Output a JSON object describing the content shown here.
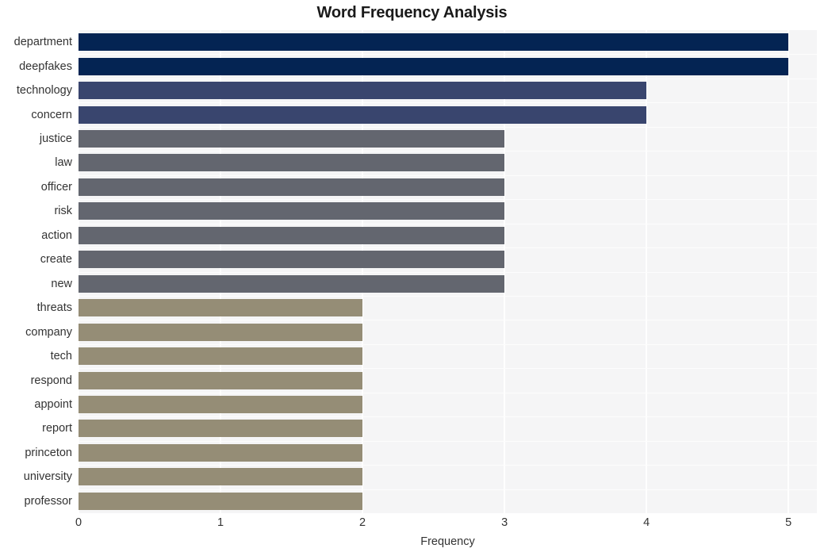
{
  "chart_data": {
    "type": "bar",
    "orientation": "horizontal",
    "title": "Word Frequency Analysis",
    "xlabel": "Frequency",
    "ylabel": "",
    "xlim": [
      0,
      5.2
    ],
    "xticks": [
      "0",
      "1",
      "2",
      "3",
      "4",
      "5"
    ],
    "xtick_values": [
      0,
      1,
      2,
      3,
      4,
      5
    ],
    "grid": true,
    "legend": "none",
    "categories": [
      "department",
      "deepfakes",
      "technology",
      "concern",
      "justice",
      "law",
      "officer",
      "risk",
      "action",
      "create",
      "new",
      "threats",
      "company",
      "tech",
      "respond",
      "appoint",
      "report",
      "princeton",
      "university",
      "professor"
    ],
    "values": [
      5,
      5,
      4,
      4,
      3,
      3,
      3,
      3,
      3,
      3,
      3,
      2,
      2,
      2,
      2,
      2,
      2,
      2,
      2,
      2
    ],
    "bar_colors": [
      "#042453",
      "#042453",
      "#39456e",
      "#39456e",
      "#63666f",
      "#63666f",
      "#63666f",
      "#63666f",
      "#63666f",
      "#63666f",
      "#63666f",
      "#958d76",
      "#958d76",
      "#958d76",
      "#958d76",
      "#958d76",
      "#958d76",
      "#958d76",
      "#958d76",
      "#958d76"
    ]
  },
  "style": {
    "plot_background": "#f5f5f6",
    "page_background": "#ffffff",
    "gridline_color": "#ffffff",
    "text_color": "#333333",
    "title_color": "#1a1a1a"
  }
}
